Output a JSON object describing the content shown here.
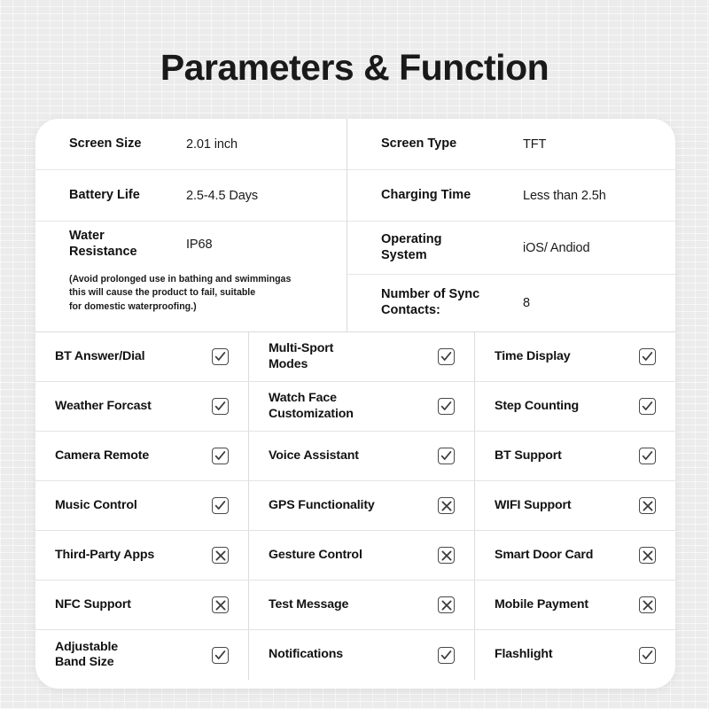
{
  "page": {
    "title": "Parameters & Function"
  },
  "specs": {
    "left": [
      {
        "label": "Screen Size",
        "value": "2.01 inch"
      },
      {
        "label": "Battery Life",
        "value": "2.5-4.5 Days"
      },
      {
        "label": "Water\nResistance",
        "label_line1": "Water",
        "label_line2": "Resistance",
        "value": "IP68"
      }
    ],
    "note": {
      "line1": "(Avoid prolonged use in bathing and swimmingas",
      "line2": "this will cause the product to fail, suitable",
      "line3": "for domestic waterproofing.)"
    },
    "right": [
      {
        "label": "Screen Type",
        "value": "TFT"
      },
      {
        "label": "Charging Time",
        "value": "Less than 2.5h"
      },
      {
        "label_line1": "Operating",
        "label_line2": "System",
        "value": "iOS/ Andiod"
      },
      {
        "label_line1": "Number of Sync",
        "label_line2": "Contacts:",
        "value": "8"
      }
    ]
  },
  "features": {
    "rows": [
      {
        "col1": {
          "label": "BT Answer/Dial",
          "mark": "check"
        },
        "col2": {
          "label_line1": "Multi-Sport",
          "label_line2": "Modes",
          "mark": "check"
        },
        "col3": {
          "label": "Time Display",
          "mark": "check"
        }
      },
      {
        "col1": {
          "label": "Weather Forcast",
          "mark": "check"
        },
        "col2": {
          "label_line1": "Watch Face",
          "label_line2": "Customization",
          "mark": "check"
        },
        "col3": {
          "label": "Step Counting",
          "mark": "check"
        }
      },
      {
        "col1": {
          "label": "Camera Remote",
          "mark": "check"
        },
        "col2": {
          "label": "Voice Assistant",
          "mark": "check"
        },
        "col3": {
          "label": "BT Support",
          "mark": "check"
        }
      },
      {
        "col1": {
          "label": "Music Control",
          "mark": "check"
        },
        "col2": {
          "label": "GPS Functionality",
          "mark": "cross"
        },
        "col3": {
          "label": "WIFI Support",
          "mark": "cross"
        }
      },
      {
        "col1": {
          "label": "Third-Party Apps",
          "mark": "cross"
        },
        "col2": {
          "label": "Gesture Control",
          "mark": "cross"
        },
        "col3": {
          "label": "Smart Door Card",
          "mark": "cross"
        }
      },
      {
        "col1": {
          "label": "NFC Support",
          "mark": "cross"
        },
        "col2": {
          "label": "Test Message",
          "mark": "cross"
        },
        "col3": {
          "label": "Mobile Payment",
          "mark": "cross"
        }
      },
      {
        "col1": {
          "label_line1": "Adjustable",
          "label_line2": "Band Size",
          "mark": "check"
        },
        "col2": {
          "label": "Notifications",
          "mark": "check"
        },
        "col3": {
          "label": "Flashlight",
          "mark": "check"
        }
      }
    ]
  },
  "colors": {
    "background": "#f1f1f1",
    "card": "#ffffff",
    "text": "#121212",
    "divider": "#e3e3e3",
    "mark_stroke": "#3a3a3a"
  }
}
